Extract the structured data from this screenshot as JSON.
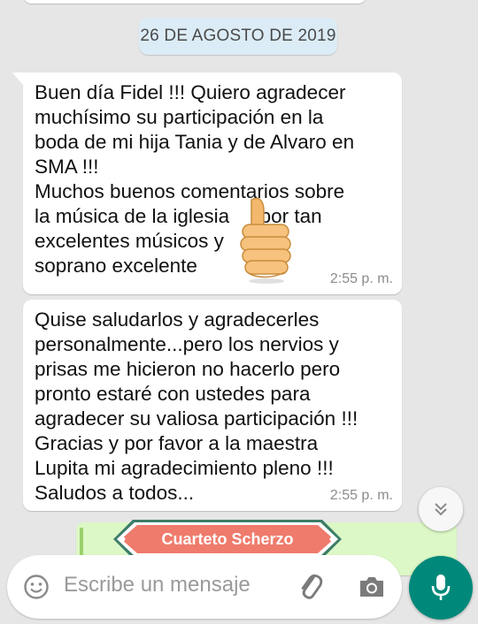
{
  "date_chip": "26 DE AGOSTO DE 2019",
  "messages": [
    {
      "text": "Buen día Fidel !!! Quiero agradecer\nmuchísimo su participación en la\nboda de mi hija Tania y de Alvaro en\nSMA !!!\nMuchos buenos comentarios sobre\nla música de la iglesia 👍 por tan\nexcelentes músicos y 👍 y la\nsoprano excelente",
      "time": "2:55 p. m.",
      "sticker": "thumbs-up-icon"
    },
    {
      "text": "Quise saludarlos y agradecerles\npersonalmente...pero los nervios y\nprisas me hicieron no hacerlo pero\npronto estaré con ustedes para\nagradecer su valiosa participación !!!\nGracias y por favor a la maestra\nLupita mi agradecimiento pleno !!!\nSaludos a todos...",
      "time": "2:55 p. m."
    }
  ],
  "banner": "Cuarteto Scherzo",
  "input": {
    "placeholder": "Escribe un mensaje"
  },
  "colors": {
    "background": "#e6e6e6",
    "incoming_bubble": "#ffffff",
    "outgoing_bubble": "#dcf8c6",
    "date_chip": "#dcecf6",
    "mic_button": "#00897b",
    "banner_fill": "#ef7b6c",
    "banner_border": "#3d7d68"
  },
  "icons": [
    "emoji-icon",
    "attach-icon",
    "camera-icon",
    "mic-icon",
    "chevron-down-icon",
    "thumbs-up-icon"
  ]
}
